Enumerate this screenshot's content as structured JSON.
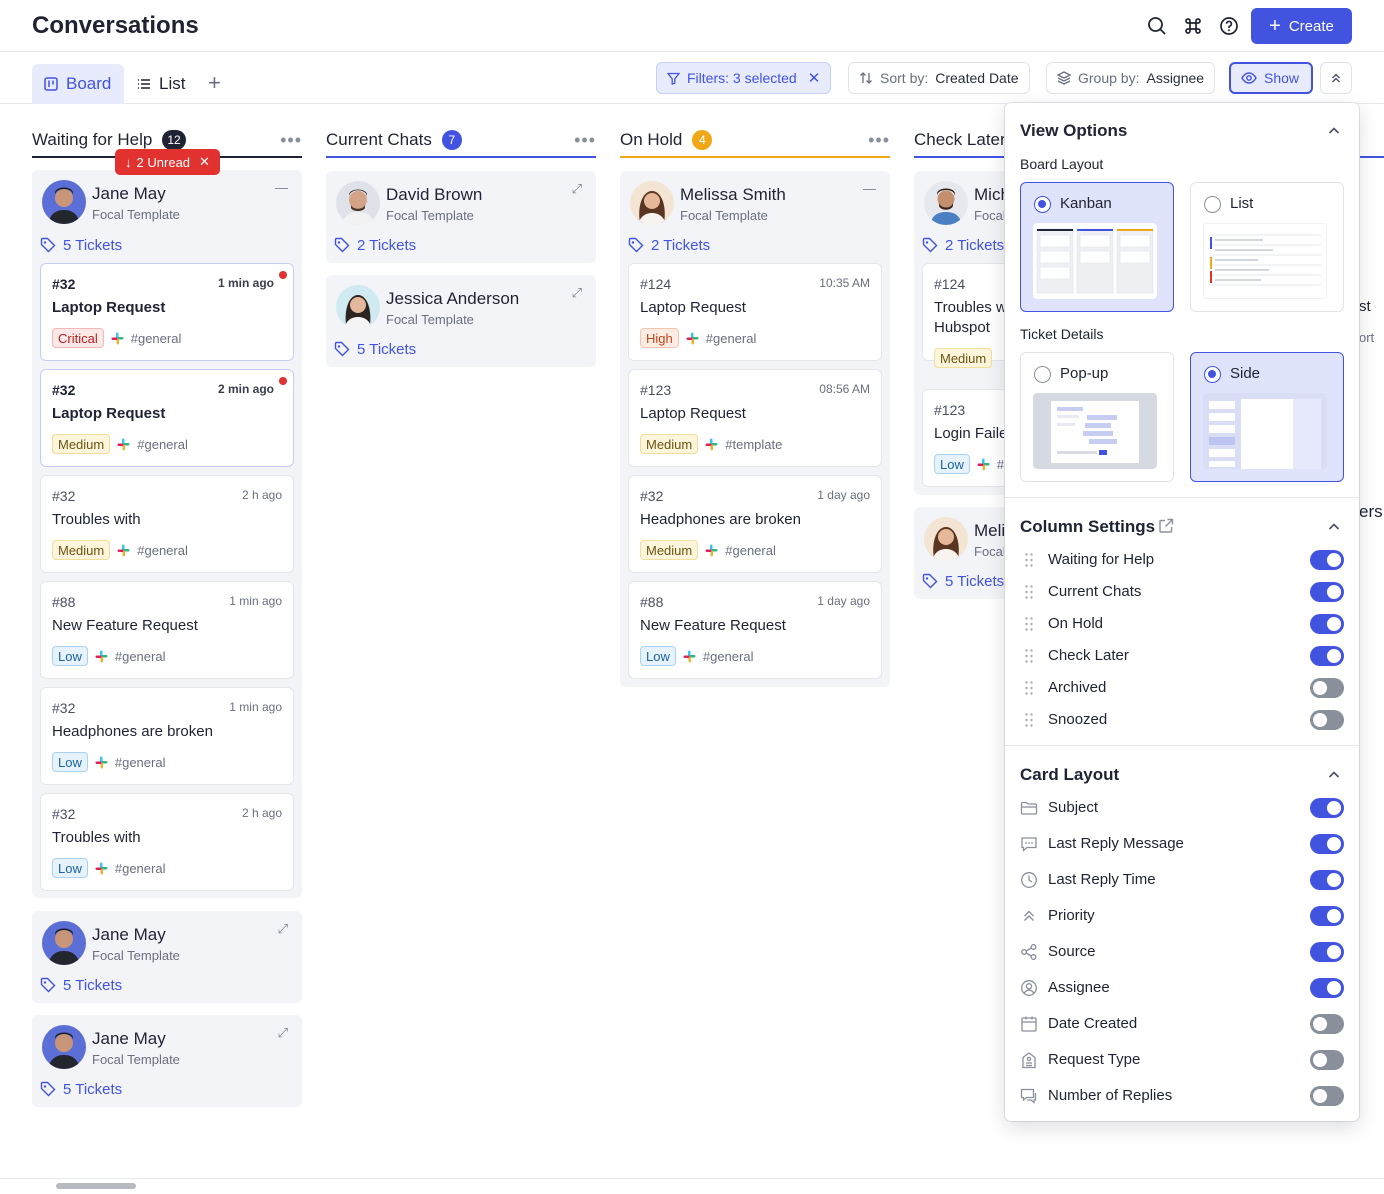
{
  "header": {
    "title": "Conversations",
    "create_label": "Create"
  },
  "view_tabs": [
    {
      "label": "Board"
    },
    {
      "label": "List"
    }
  ],
  "toolbar": {
    "filters": "Filters: 3 selected",
    "sort_prefix": "Sort by:",
    "sort_value": "Created Date",
    "group_prefix": "Group by:",
    "group_value": "Assignee",
    "show": "Show"
  },
  "columns": [
    {
      "title": "Waiting for Help",
      "count": "12",
      "color": "#1f2333"
    },
    {
      "title": "Current Chats",
      "count": "7",
      "color": "#4253e0"
    },
    {
      "title": "On Hold",
      "count": "4",
      "color": "#f0a818"
    },
    {
      "title": "Check Later",
      "count": "",
      "color": "#4253e0"
    }
  ],
  "unread_pill": "2 Unread",
  "col1": {
    "g1": {
      "name": "Jane May",
      "template": "Focal Template",
      "tickets": "5 Tickets"
    },
    "cards": [
      {
        "id": "#32",
        "time": "1 min ago",
        "subject": "Laptop Request",
        "priority": "Critical",
        "channel": "#general"
      },
      {
        "id": "#32",
        "time": "2 min ago",
        "subject": "Laptop Request",
        "priority": "Medium",
        "channel": "#general"
      },
      {
        "id": "#32",
        "time": "2 h ago",
        "subject": "Troubles with",
        "priority": "Medium",
        "channel": "#general"
      },
      {
        "id": "#88",
        "time": "1 min ago",
        "subject": "New Feature Request",
        "priority": "Low",
        "channel": "#general"
      },
      {
        "id": "#32",
        "time": "1 min ago",
        "subject": "Headphones are broken",
        "priority": "Low",
        "channel": "#general"
      },
      {
        "id": "#32",
        "time": "2 h ago",
        "subject": "Troubles with",
        "priority": "Low",
        "channel": "#general"
      }
    ],
    "g2": {
      "name": "Jane May",
      "template": "Focal Template",
      "tickets": "5 Tickets"
    },
    "g3": {
      "name": "Jane May",
      "template": "Focal Template",
      "tickets": "5 Tickets"
    }
  },
  "col2": {
    "g1": {
      "name": "David Brown",
      "template": "Focal Template",
      "tickets": "2 Tickets"
    },
    "g2": {
      "name": "Jessica Anderson",
      "template": "Focal Template",
      "tickets": "5 Tickets"
    }
  },
  "col3": {
    "g1": {
      "name": "Melissa Smith",
      "template": "Focal Template",
      "tickets": "2 Tickets"
    },
    "cards": [
      {
        "id": "#124",
        "time": "10:35 AM",
        "subject": "Laptop Request",
        "priority": "High",
        "channel": "#general"
      },
      {
        "id": "#123",
        "time": "08:56 AM",
        "subject": "Laptop Request",
        "priority": "Medium",
        "channel": "#template"
      },
      {
        "id": "#32",
        "time": "1 day ago",
        "subject": "Headphones are broken",
        "priority": "Medium",
        "channel": "#general"
      },
      {
        "id": "#88",
        "time": "1 day ago",
        "subject": "New Feature Request",
        "priority": "Low",
        "channel": "#general"
      }
    ]
  },
  "col4": {
    "g1": {
      "name": "Mich",
      "template": "Focal",
      "tickets": "2 Tickets"
    },
    "cards": [
      {
        "id": "#124",
        "subject_l1": "Troubles w",
        "subject_l2": "Hubspot",
        "priority": "Medium"
      },
      {
        "id": "#123",
        "subject": "Login Faile",
        "priority": "Low",
        "channel": "#"
      }
    ],
    "g2": {
      "name": "Meli",
      "template": "Focal",
      "tickets": "5 Tickets"
    },
    "peek1": "st",
    "peek2": "ort",
    "peek3": "ers"
  },
  "panel": {
    "view_options": "View Options",
    "board_layout": "Board Layout",
    "kanban": "Kanban",
    "list": "List",
    "ticket_details": "Ticket Details",
    "popup": "Pop-up",
    "side": "Side",
    "column_settings": "Column Settings",
    "columns": [
      {
        "label": "Waiting for Help",
        "on": true
      },
      {
        "label": "Current Chats",
        "on": true
      },
      {
        "label": "On Hold",
        "on": true
      },
      {
        "label": "Check Later",
        "on": true
      },
      {
        "label": "Archived",
        "on": false
      },
      {
        "label": "Snoozed",
        "on": false
      }
    ],
    "card_layout": "Card Layout",
    "card_fields": [
      {
        "label": "Subject",
        "icon": "folder-icon",
        "on": true
      },
      {
        "label": "Last Reply Message",
        "icon": "message-icon",
        "on": true
      },
      {
        "label": "Last Reply Time",
        "icon": "clock-icon",
        "on": true
      },
      {
        "label": "Priority",
        "icon": "priority-icon",
        "on": true
      },
      {
        "label": "Source",
        "icon": "share-icon",
        "on": true
      },
      {
        "label": "Assignee",
        "icon": "user-circle-icon",
        "on": true
      },
      {
        "label": "Date Created",
        "icon": "calendar-icon",
        "on": false
      },
      {
        "label": "Request Type",
        "icon": "building-icon",
        "on": false
      },
      {
        "label": "Number of Replies",
        "icon": "replies-icon",
        "on": false
      }
    ]
  }
}
